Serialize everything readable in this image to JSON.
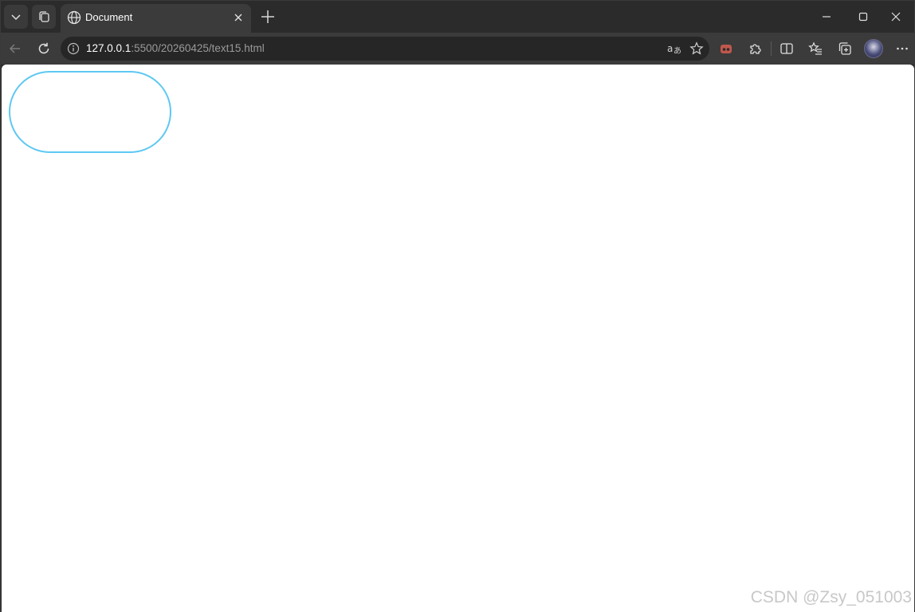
{
  "tab": {
    "title": "Document"
  },
  "address_bar": {
    "host": "127.0.0.1",
    "rest": ":5500/20260425/text15.html"
  },
  "icons": {
    "tab_list": "chevron-down-icon",
    "workspaces": "workspaces-icon",
    "tab_favicon": "globe-icon",
    "tab_close": "close-icon",
    "new_tab": "plus-icon",
    "minimize": "minimize-icon",
    "maximize": "maximize-icon",
    "close_window": "close-icon",
    "back": "back-arrow-icon",
    "refresh": "refresh-icon",
    "site_info": "info-icon",
    "read_aloud": "translate-icon",
    "favorite": "star-icon",
    "extension_red": "extension-icon",
    "extensions": "puzzle-icon",
    "split_screen": "split-screen-icon",
    "favorites": "favorites-list-icon",
    "collections": "collections-icon",
    "profile": "avatar",
    "more": "more-icon"
  },
  "colors": {
    "pill_border": "#5ec8f2",
    "page_background": "#ffffff",
    "chrome_dark": "#2b2b2b",
    "toolbar": "#3b3b3b"
  },
  "watermark": {
    "text": "CSDN @Zsy_051003"
  }
}
